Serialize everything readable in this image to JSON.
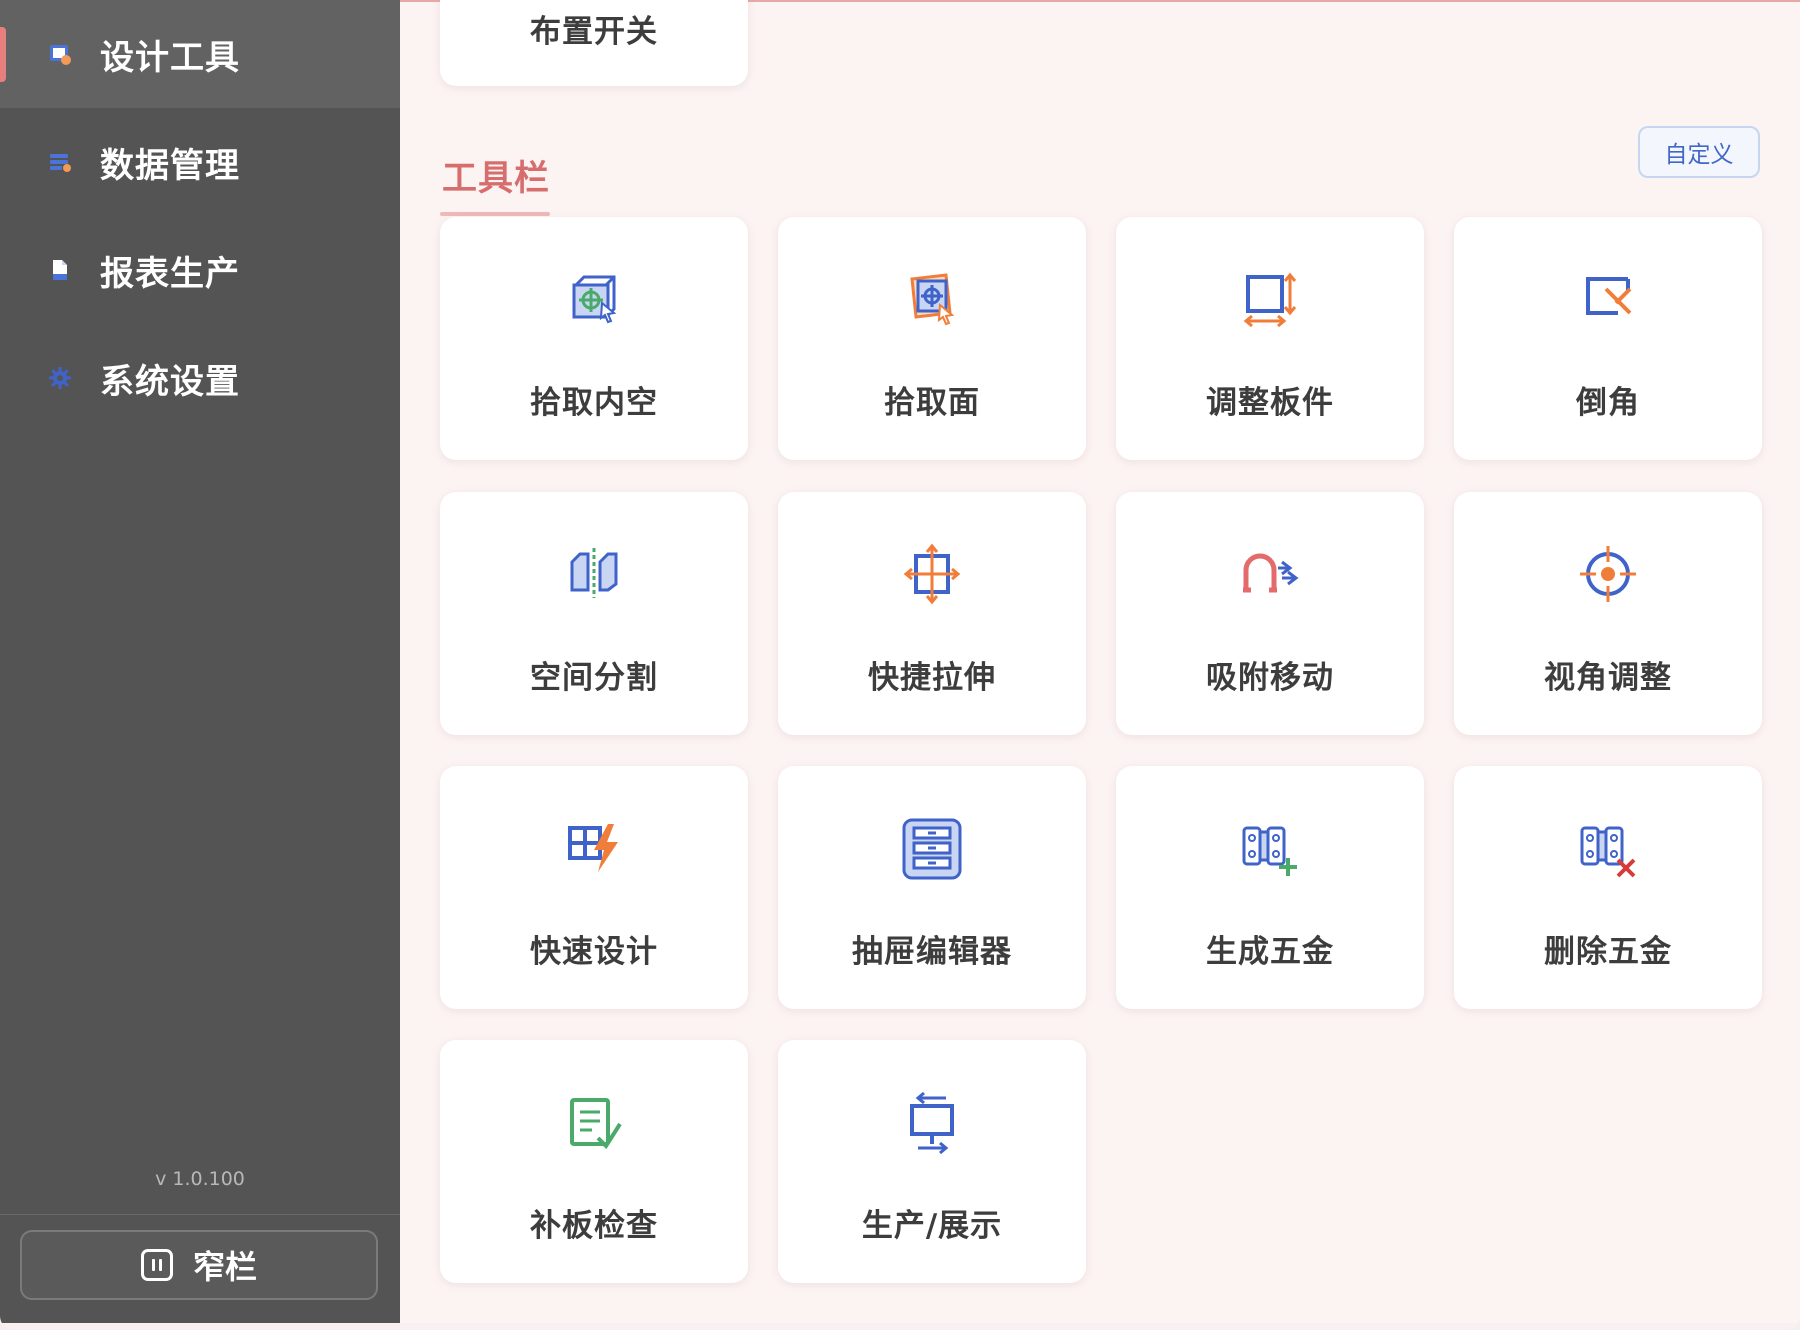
{
  "sidebar": {
    "items": [
      {
        "label": "设计工具",
        "icon": "design-tool-icon",
        "active": true
      },
      {
        "label": "数据管理",
        "icon": "data-management-icon",
        "active": false
      },
      {
        "label": "报表生产",
        "icon": "report-document-icon",
        "active": false
      },
      {
        "label": "系统设置",
        "icon": "gear-icon",
        "active": false
      }
    ],
    "version": "v 1.0.100",
    "collapse_label": "窄栏"
  },
  "main": {
    "top_card_label": "布置开关",
    "section_title": "工具栏",
    "customize_label": "自定义",
    "tools": [
      {
        "label": "拾取内空",
        "icon": "pick-inner-space-icon"
      },
      {
        "label": "拾取面",
        "icon": "pick-face-icon"
      },
      {
        "label": "调整板件",
        "icon": "adjust-panel-icon"
      },
      {
        "label": "倒角",
        "icon": "chamfer-icon"
      },
      {
        "label": "空间分割",
        "icon": "space-split-icon"
      },
      {
        "label": "快捷拉伸",
        "icon": "quick-stretch-icon"
      },
      {
        "label": "吸附移动",
        "icon": "magnet-move-icon"
      },
      {
        "label": "视角调整",
        "icon": "view-angle-icon"
      },
      {
        "label": "快速设计",
        "icon": "quick-design-icon"
      },
      {
        "label": "抽屉编辑器",
        "icon": "drawer-editor-icon"
      },
      {
        "label": "生成五金",
        "icon": "generate-hardware-icon"
      },
      {
        "label": "删除五金",
        "icon": "delete-hardware-icon"
      },
      {
        "label": "补板检查",
        "icon": "panel-check-icon"
      },
      {
        "label": "生产/展示",
        "icon": "production-display-icon"
      }
    ]
  },
  "colors": {
    "sidebar_bg": "#545454",
    "accent": "#d66e6e",
    "icon_blue": "#3f63c9",
    "icon_orange": "#f07e3a",
    "icon_green": "#4aaa6a"
  }
}
